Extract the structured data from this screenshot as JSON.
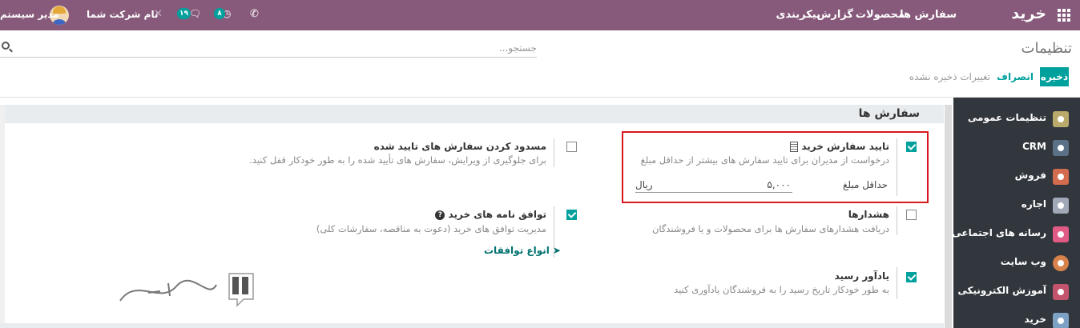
{
  "topbar": {
    "brand": "خرید",
    "menu": [
      "سفارش ها",
      "محصولات",
      "گزارش",
      "پیکربندی"
    ],
    "user_name": "مدیر سیستم",
    "company_name": "نام شرکت شما",
    "messages_count": "۱۹",
    "activities_count": "۸",
    "bg_color": "#875a7b"
  },
  "control_panel": {
    "title": "تنظیمات",
    "search_placeholder": "جستجو...",
    "save_label": "ذخیره",
    "cancel_label": "انصراف",
    "unsaved_label": "تغییرات ذخیره نشده"
  },
  "sidebar": {
    "items": [
      {
        "label": "تنظیمات عمومی",
        "color": "#b9a96b",
        "icon": "gear-icon"
      },
      {
        "label": "CRM",
        "color": "#5b7187",
        "icon": "handshake-icon"
      },
      {
        "label": "فروش",
        "color": "#d36b4e",
        "icon": "chart-icon"
      },
      {
        "label": "اجاره",
        "color": "#a1a8b8",
        "icon": "rental-icon"
      },
      {
        "label": "رسانه های اجتماعی",
        "color": "#e25b86",
        "icon": "thumbs-up-icon"
      },
      {
        "label": "وب سایت",
        "color": "#d8824b",
        "icon": "globe-icon"
      },
      {
        "label": "آموزش الکترونیکی",
        "color": "#c3546d",
        "icon": "elearning-icon"
      },
      {
        "label": "خرید",
        "color": "#7da1c4",
        "icon": "purchase-icon"
      }
    ]
  },
  "section": {
    "title": "سفارش ها",
    "settings": {
      "approval": {
        "title": "تایید سفارش خرید",
        "desc": "درخواست از مدیران برای تایید سفارش های بیشتر از حداقل مبلغ",
        "checked": true,
        "amount_label": "حداقل مبلغ",
        "amount_value": "۵,۰۰۰",
        "currency": "ریال"
      },
      "lock": {
        "title": "مسدود کردن سفارش های تایید شده",
        "desc": "برای جلوگیری از ویرایش، سفارش های تأیید شده را به طور خودکار قفل کنید.",
        "checked": false
      },
      "warnings": {
        "title": "هشدارها",
        "desc": "دریافت هشدارهای سفارش ها برای محصولات و یا فروشندگان",
        "checked": false
      },
      "agreements": {
        "title": "توافق نامه های خرید",
        "desc": "مدیریت توافق های خرید (دعوت به مناقصه، سفارشات کلی)",
        "checked": true,
        "link": "انواع توافقات"
      },
      "reminder": {
        "title": "یادآور رسید",
        "desc": "به طور خودکار تاریخ رسید را به فروشندگان یادآوری کنید",
        "checked": true
      }
    }
  }
}
